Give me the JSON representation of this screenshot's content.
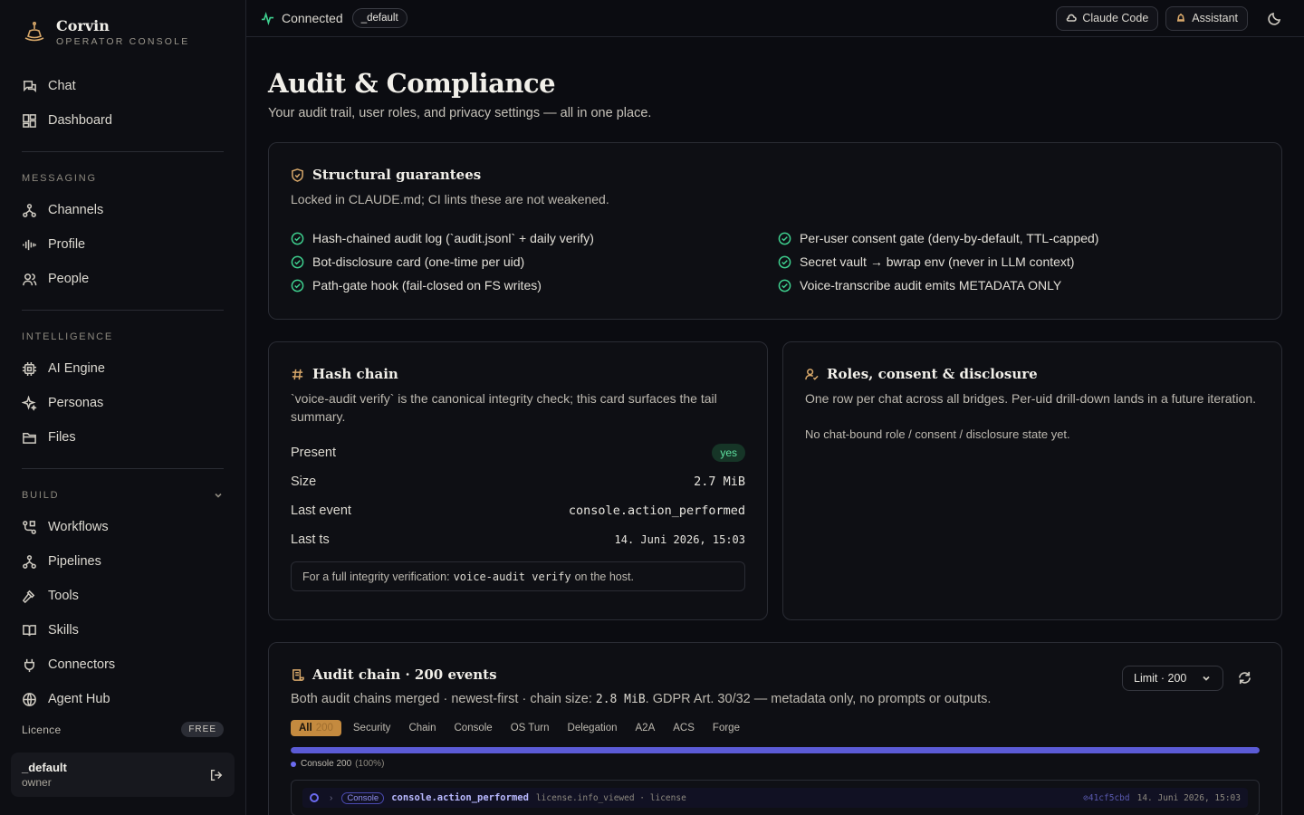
{
  "brand": {
    "name": "Corvin",
    "subtitle": "OPERATOR CONSOLE"
  },
  "sidebar": {
    "top_items": [
      {
        "label": "Chat",
        "icon": "chat-icon"
      },
      {
        "label": "Dashboard",
        "icon": "dashboard-icon"
      }
    ],
    "groups": [
      {
        "label": "MESSAGING",
        "items": [
          {
            "label": "Channels",
            "icon": "channels-icon"
          },
          {
            "label": "Profile",
            "icon": "waveform-icon"
          },
          {
            "label": "People",
            "icon": "people-icon"
          }
        ]
      },
      {
        "label": "INTELLIGENCE",
        "items": [
          {
            "label": "AI Engine",
            "icon": "cpu-icon"
          },
          {
            "label": "Personas",
            "icon": "sparkles-icon"
          },
          {
            "label": "Files",
            "icon": "folder-icon"
          }
        ]
      },
      {
        "label": "BUILD",
        "items": [
          {
            "label": "Workflows",
            "icon": "workflow-icon"
          },
          {
            "label": "Pipelines",
            "icon": "pipeline-icon"
          },
          {
            "label": "Tools",
            "icon": "hammer-icon"
          },
          {
            "label": "Skills",
            "icon": "book-icon"
          },
          {
            "label": "Connectors",
            "icon": "plug-icon"
          },
          {
            "label": "Agent Hub",
            "icon": "globe-icon"
          }
        ]
      }
    ],
    "licence": {
      "label": "Licence",
      "badge": "FREE"
    },
    "user": {
      "name": "_default",
      "role": "owner"
    }
  },
  "topbar": {
    "status": "Connected",
    "workspace": "_default",
    "claude_code_label": "Claude Code",
    "assistant_label": "Assistant"
  },
  "page": {
    "title": "Audit & Compliance",
    "subtitle": "Your audit trail, user roles, and privacy settings — all in one place."
  },
  "guarantees": {
    "title": "Structural guarantees",
    "description": "Locked in CLAUDE.md; CI lints these are not weakened.",
    "items": [
      "Hash-chained audit log (`audit.jsonl` + daily verify)",
      "Per-user consent gate (deny-by-default, TTL-capped)",
      "Bot-disclosure card (one-time per uid)",
      "Secret vault → bwrap env (never in LLM context)",
      "Path-gate hook (fail-closed on FS writes)",
      "Voice-transcribe audit emits METADATA ONLY"
    ]
  },
  "hash_chain": {
    "title": "Hash chain",
    "description": "`voice-audit verify` is the canonical integrity check; this card surfaces the tail summary.",
    "rows": [
      {
        "key": "Present",
        "value": "yes"
      },
      {
        "key": "Size",
        "value": "2.7 MiB"
      },
      {
        "key": "Last event",
        "value": "console.action_performed"
      },
      {
        "key": "Last ts",
        "value": "14. Juni 2026, 15:03"
      }
    ],
    "note_prefix": "For a full integrity verification:",
    "note_code": "voice-audit verify",
    "note_suffix": "on the host."
  },
  "roles": {
    "title": "Roles, consent & disclosure",
    "description": "One row per chat across all bridges. Per-uid drill-down lands in a future iteration.",
    "empty": "No chat-bound role / consent / disclosure state yet."
  },
  "audit_chain": {
    "title": "Audit chain · 200 events",
    "desc_prefix": "Both audit chains merged · newest-first · chain size:",
    "desc_size": "2.8 MiB",
    "desc_suffix": ". GDPR Art. 30/32 — metadata only, no prompts or outputs.",
    "limit_label": "Limit · 200",
    "filters": [
      {
        "label": "All",
        "count": "200",
        "active": true
      },
      {
        "label": "Security"
      },
      {
        "label": "Chain"
      },
      {
        "label": "Console"
      },
      {
        "label": "OS Turn"
      },
      {
        "label": "Delegation"
      },
      {
        "label": "A2A"
      },
      {
        "label": "ACS"
      },
      {
        "label": "Forge"
      }
    ],
    "bar_fraction": 1.0,
    "bar_color": "#5b5bd6",
    "legend": {
      "label": "Console",
      "count": "200",
      "pct": "(100%)"
    },
    "event": {
      "tag": "Console",
      "name": "console.action_performed",
      "meta": "license.info_viewed · license",
      "hash": "⊘41cf5cbd",
      "ts": "14. Juni 2026, 15:03"
    }
  },
  "colors": {
    "accent": "#c48a3f",
    "ok": "#3ecf8e",
    "console": "#5b5bd6",
    "background": "#0b0c11"
  }
}
